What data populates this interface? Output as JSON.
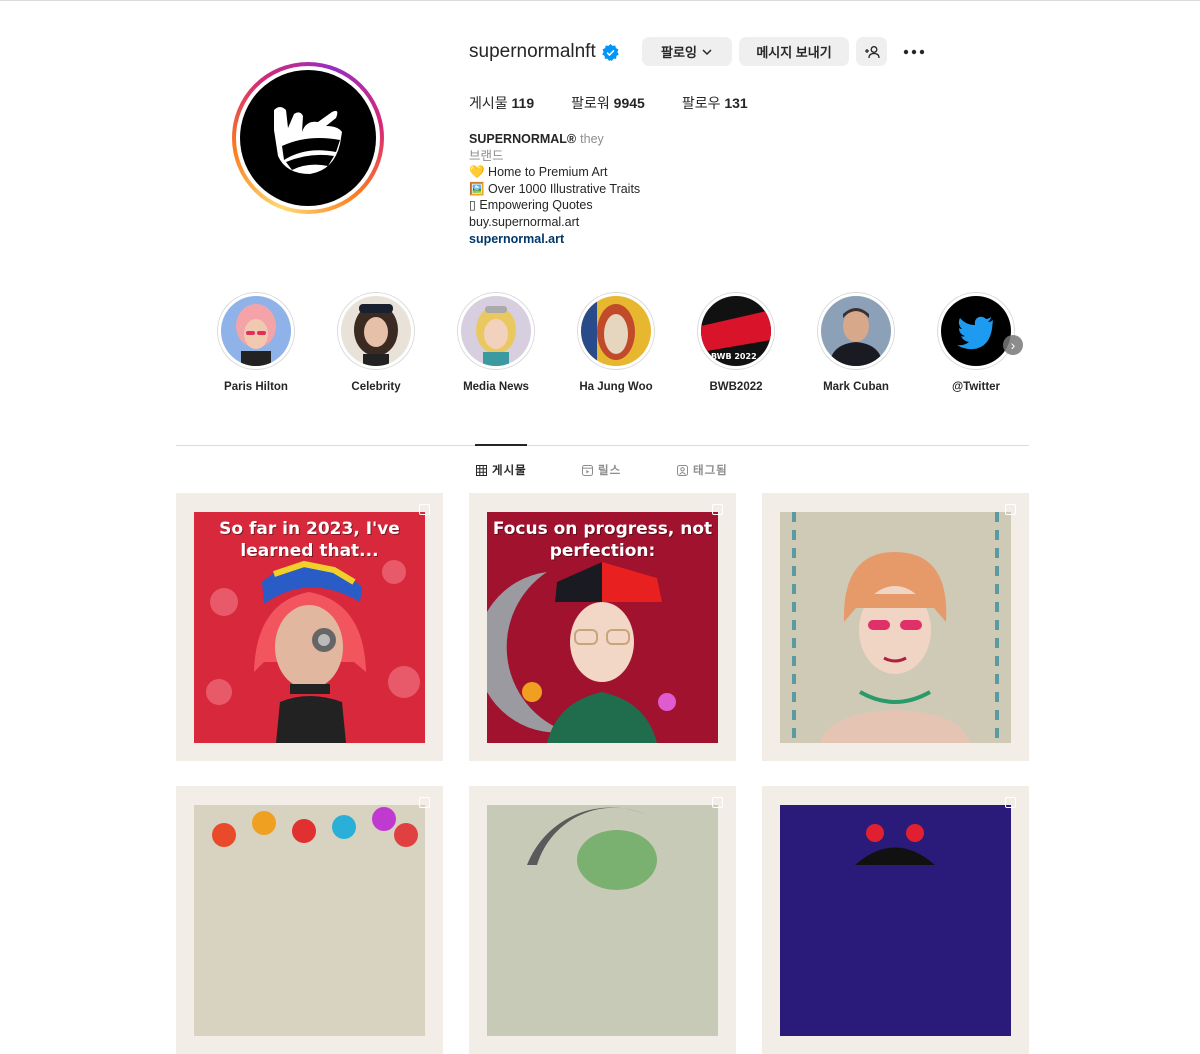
{
  "profile": {
    "username": "supernormalnft",
    "follow_label": "팔로잉",
    "message_label": "메시지 보내기",
    "stats": {
      "posts_label": "게시물",
      "posts": "119",
      "followers_label": "팔로워",
      "followers": "9945",
      "following_label": "팔로우",
      "following": "131"
    },
    "bio": {
      "name": "SUPERNORMAL®",
      "pronouns": "they",
      "category": "브랜드",
      "line1": "💛 Home to Premium Art",
      "line2": "🖼️ Over 1000 Illustrative Traits",
      "line3": "▯ Empowering Quotes",
      "line4": "buy.supernormal.art",
      "link": "supernormal.art"
    }
  },
  "highlights": [
    {
      "label": "Paris Hilton"
    },
    {
      "label": "Celebrity"
    },
    {
      "label": "Media News"
    },
    {
      "label": "Ha Jung Woo"
    },
    {
      "label": "BWB2022"
    },
    {
      "label": "Mark Cuban"
    },
    {
      "label": "@Twitter"
    }
  ],
  "highlight_text": {
    "bwb": "BWB 2022"
  },
  "tabs": {
    "posts": "게시물",
    "reels": "릴스",
    "tagged": "태그됨"
  },
  "posts": [
    {
      "caption": "So far in 2023, I've learned that..."
    },
    {
      "caption": "Focus on progress, not perfection:"
    },
    {
      "caption": ""
    },
    {
      "caption": ""
    },
    {
      "caption": ""
    },
    {
      "caption": ""
    }
  ],
  "colors": {
    "verified": "#0095f6",
    "link": "#00376b",
    "button_bg": "#efefef",
    "post_frame": "#f3ede7"
  }
}
